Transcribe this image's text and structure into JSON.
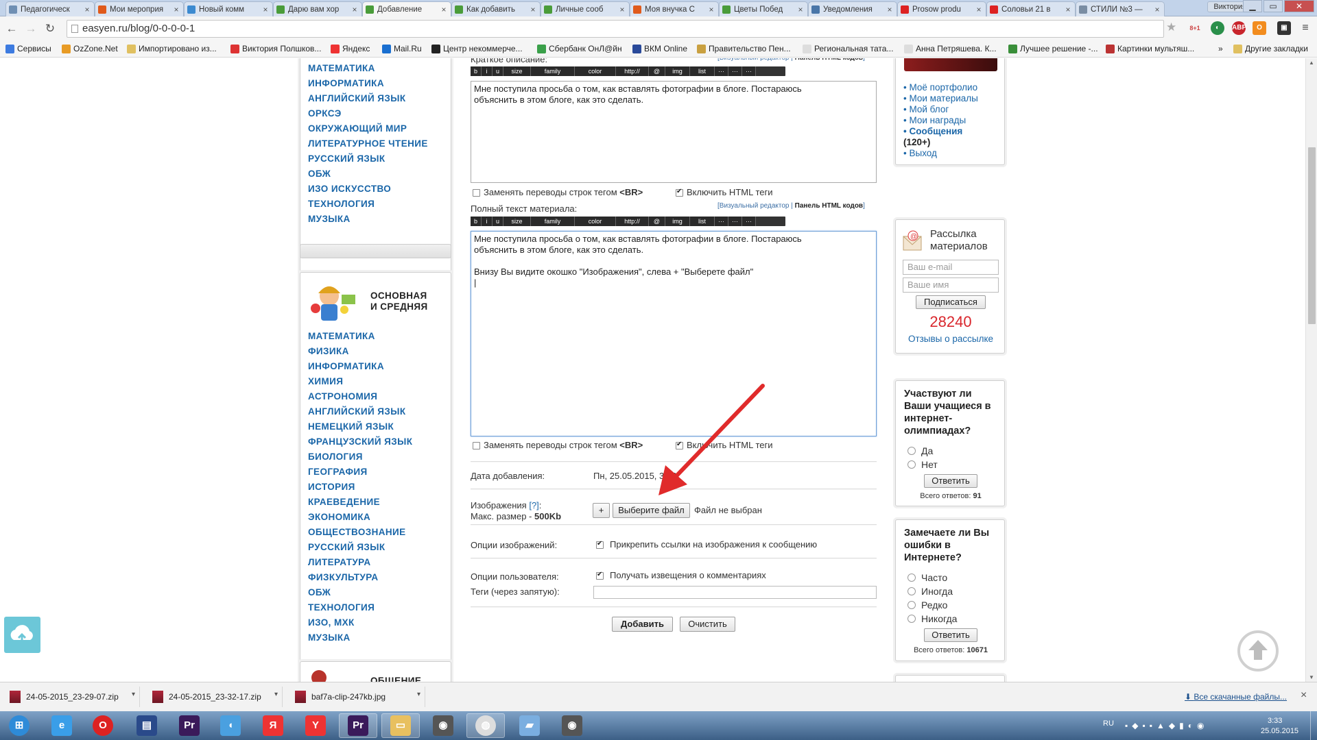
{
  "browser": {
    "tabs": [
      {
        "title": "Педагогическ",
        "color": "#6f8fb3"
      },
      {
        "title": "Мои мероприя",
        "color": "#e05a1b"
      },
      {
        "title": "Новый комм",
        "color": "#3c8ad0"
      },
      {
        "title": "Дарю вам хор",
        "color": "#4a9c3a"
      },
      {
        "title": "Добавление",
        "color": "#4a9c3a"
      },
      {
        "title": "Как добавить",
        "color": "#4a9c3a"
      },
      {
        "title": "Личные сооб",
        "color": "#4a9c3a"
      },
      {
        "title": "Моя внучка С",
        "color": "#e05a1b"
      },
      {
        "title": "Цветы Побед",
        "color": "#4a9c3a"
      },
      {
        "title": "Уведомления",
        "color": "#4a76a8"
      },
      {
        "title": "Prosow produ",
        "color": "#d22"
      },
      {
        "title": "Соловьи 21 в",
        "color": "#d22"
      },
      {
        "title": "СТИЛИ №3 —",
        "color": "#7a8da3"
      }
    ],
    "active_tab_index": 4,
    "user_badge": "Виктория",
    "url": "easyen.ru/blog/0-0-0-0-1",
    "ext_badge": "8+1",
    "bookmarks": [
      "Сервисы",
      "OzZone.Net",
      "Импортировано из...",
      "Виктория Полшков...",
      "Яндекс",
      "Mail.Ru",
      "Центр некоммерче...",
      "Сбербанк ОнЛ@йн",
      "ВКМ Online",
      "Правительство Пен...",
      "Региональная тата...",
      "Анна Петряшева. К...",
      "Лучшее решение -...",
      "Картинки мультяш...",
      "Другие закладки"
    ],
    "bookmarks_more": "»"
  },
  "left_sidebar": {
    "top_subjects": [
      "МАТЕМАТИКА",
      "ИНФОРМАТИКА",
      "АНГЛИЙСКИЙ ЯЗЫК",
      "ОРКСЭ",
      "ОКРУЖАЮЩИЙ МИР",
      "ЛИТЕРАТУРНОЕ ЧТЕНИЕ",
      "РУССКИЙ ЯЗЫК",
      "ОБЖ",
      "ИЗО ИСКУССТВО",
      "ТЕХНОЛОГИЯ",
      "МУЗЫКА"
    ],
    "school_title_1": "ОСНОВНАЯ",
    "school_title_2": "И СРЕДНЯЯ",
    "school_subjects": [
      "МАТЕМАТИКА",
      "ФИЗИКА",
      "ИНФОРМАТИКА",
      "ХИМИЯ",
      "АСТРОНОМИЯ",
      "АНГЛИЙСКИЙ ЯЗЫК",
      "НЕМЕЦКИЙ ЯЗЫК",
      "ФРАНЦУЗСКИЙ ЯЗЫК",
      "БИОЛОГИЯ",
      "ГЕОГРАФИЯ",
      "ИСТОРИЯ",
      "КРАЕВЕДЕНИЕ",
      "ЭКОНОМИКА",
      "ОБЩЕСТВОЗНАНИЕ",
      "РУССКИЙ ЯЗЫК",
      "ЛИТЕРАТУРА",
      "ФИЗКУЛЬТУРА",
      "ОБЖ",
      "ТЕХНОЛОГИЯ",
      "ИЗО, МХК",
      "МУЗЫКА"
    ],
    "next_title": "ОБЩЕНИЕ"
  },
  "form": {
    "short_label": "Краткое описание:",
    "editor_links_visual": "Визуальный редактор",
    "editor_links_html": "Панель HTML кодов",
    "toolbar": [
      "b",
      "i",
      "u",
      "size",
      "family",
      "color",
      "http://",
      "@",
      "img",
      "list",
      "···",
      "···",
      "···"
    ],
    "short_text": "Мне поступила просьба о том, как вставлять фотографии в блоге. Постараюсь\nобъяснить в этом блоге, как это сделать.",
    "br_label": "Заменять переводы строк тегом",
    "br_tag": "<BR>",
    "html_label": "Включить HTML теги",
    "full_label": "Полный текст материала:",
    "full_text": "Мне поступила просьба о том, как вставлять фотографии в блоге. Постараюсь\nобъяснить в этом блоге, как это сделать.\n\nВнизу Вы видите окошко \"Изображения\", слева + \"Выберете файл\"\n|",
    "date_label": "Дата добавления:",
    "date_value": "Пн, 25.05.2015, 3:22",
    "images_label": "Изображения",
    "images_help": "[?]",
    "images_max": "Макс. размер -",
    "images_max_value": "500Kb",
    "plus_label": "+",
    "choose_file": "Выберите файл",
    "no_file": "Файл не выбран",
    "img_options_label": "Опции изображений:",
    "img_options_value": "Прикрепить ссылки на изображения к сообщению",
    "user_options_label": "Опции пользователя:",
    "user_options_value": "Получать извещения о комментариях",
    "tags_label": "Теги (через запятую):",
    "tags_value": "",
    "add_button": "Добавить",
    "clear_button": "Очистить"
  },
  "right_sidebar": {
    "account_links": [
      "Моё портфолио",
      "Мои материалы",
      "Мой блог",
      "Мои награды"
    ],
    "messages": "Сообщения",
    "messages_count": "(120+)",
    "logout": "Выход",
    "newsletter_title_1": "Рассылка",
    "newsletter_title_2": "материалов",
    "email_placeholder": "Ваш e-mail",
    "name_placeholder": "Ваше имя",
    "subscribe": "Подписаться",
    "subscribers": "28240",
    "reviews": "Отзывы о рассылке",
    "poll1_question": "Участвуют ли Ваши учащиеся в интернет-олимпиадах?",
    "poll1_options": [
      "Да",
      "Нет"
    ],
    "poll1_answer": "Ответить",
    "poll1_total_label": "Всего ответов:",
    "poll1_total": "91",
    "poll2_question": "Замечаете ли Вы ошибки в Интернете?",
    "poll2_options": [
      "Часто",
      "Иногда",
      "Редко",
      "Никогда"
    ],
    "poll2_answer": "Ответить",
    "poll2_total_label": "Всего ответов:",
    "poll2_total": "10671"
  },
  "downloads": {
    "items": [
      "24-05-2015_23-29-07.zip",
      "24-05-2015_23-32-17.zip",
      "baf7a-clip-247kb.jpg"
    ],
    "show_all": "Все скачанные файлы...",
    "close": "×"
  },
  "taskbar": {
    "apps": [
      "start",
      "ie",
      "opera",
      "save",
      "premiere",
      "audio",
      "yandex",
      "yandex-browser",
      "premiere",
      "explorer",
      "camera",
      "chrome",
      "paint",
      "camera"
    ],
    "lang": "RU",
    "time": "3:33",
    "date": "25.05.2015"
  },
  "colors": {
    "link_blue": "#1a66a8",
    "subscriber_red": "#d9262c",
    "annotation_arrow": "#e02b2b"
  }
}
